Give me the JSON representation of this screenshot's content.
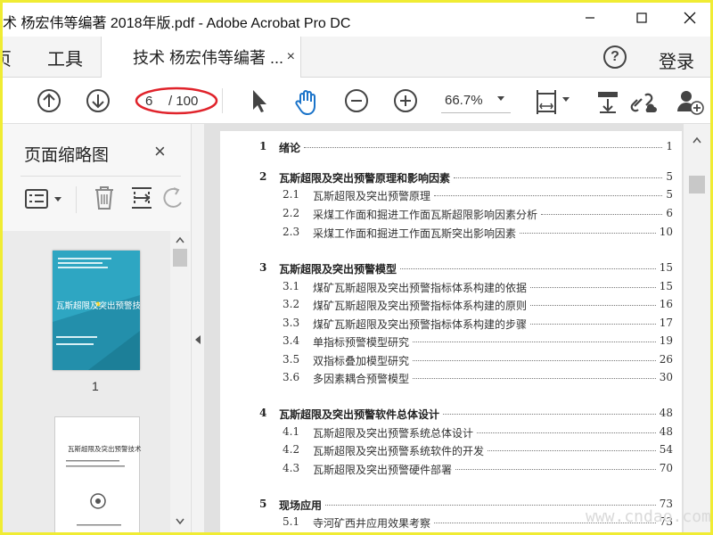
{
  "window": {
    "title": "术 杨宏伟等编著 2018年版.pdf - Adobe Acrobat Pro DC",
    "controls": [
      "minimize",
      "maximize",
      "close"
    ]
  },
  "tabs": {
    "home_partial": "页",
    "tools": "工具",
    "document": "技术 杨宏伟等编著 ...",
    "document_close": "×",
    "help": "?",
    "login": "登录"
  },
  "toolbar": {
    "current_page": "6",
    "total_pages": "/ 100",
    "zoom": "66.7%",
    "annotation_color": "#e0232b"
  },
  "sidebar": {
    "title": "页面缩略图",
    "close": "×",
    "thumbnails": [
      {
        "label": "1",
        "cover_title": "瓦斯超限及突出预警技术",
        "cover_color": "#2ea6c2"
      },
      {
        "label": "",
        "inner_title": "瓦斯超限及突出预警技术"
      }
    ]
  },
  "toc": [
    {
      "num": "1",
      "title": "绪论",
      "page": "1",
      "chapter": true
    },
    {
      "num": "2",
      "title": "瓦斯超限及突出预警原理和影响因素",
      "page": "5",
      "chapter": true
    },
    {
      "num": "2.1",
      "title": "瓦斯超限及突出预警原理",
      "page": "5",
      "chapter": false
    },
    {
      "num": "2.2",
      "title": "采煤工作面和掘进工作面瓦斯超限影响因素分析",
      "page": "6",
      "chapter": false
    },
    {
      "num": "2.3",
      "title": "采煤工作面和掘进工作面瓦斯突出影响因素",
      "page": "10",
      "chapter": false
    },
    {
      "num": "3",
      "title": "瓦斯超限及突出预警模型",
      "page": "15",
      "chapter": true
    },
    {
      "num": "3.1",
      "title": "煤矿瓦斯超限及突出预警指标体系构建的依据",
      "page": "15",
      "chapter": false
    },
    {
      "num": "3.2",
      "title": "煤矿瓦斯超限及突出预警指标体系构建的原则",
      "page": "16",
      "chapter": false
    },
    {
      "num": "3.3",
      "title": "煤矿瓦斯超限及突出预警指标体系构建的步骤",
      "page": "17",
      "chapter": false
    },
    {
      "num": "3.4",
      "title": "单指标预警模型研究",
      "page": "19",
      "chapter": false
    },
    {
      "num": "3.5",
      "title": "双指标叠加模型研究",
      "page": "26",
      "chapter": false
    },
    {
      "num": "3.6",
      "title": "多因素耦合预警模型",
      "page": "30",
      "chapter": false
    },
    {
      "num": "4",
      "title": "瓦斯超限及突出预警软件总体设计",
      "page": "48",
      "chapter": true
    },
    {
      "num": "4.1",
      "title": "瓦斯超限及突出预警系统总体设计",
      "page": "48",
      "chapter": false
    },
    {
      "num": "4.2",
      "title": "瓦斯超限及突出预警系统软件的开发",
      "page": "54",
      "chapter": false
    },
    {
      "num": "4.3",
      "title": "瓦斯超限及突出预警硬件部署",
      "page": "70",
      "chapter": false
    },
    {
      "num": "5",
      "title": "现场应用",
      "page": "73",
      "chapter": true
    },
    {
      "num": "5.1",
      "title": "寺河矿西井应用效果考察",
      "page": "73",
      "chapter": false
    }
  ],
  "watermark": "www.cndao.com"
}
